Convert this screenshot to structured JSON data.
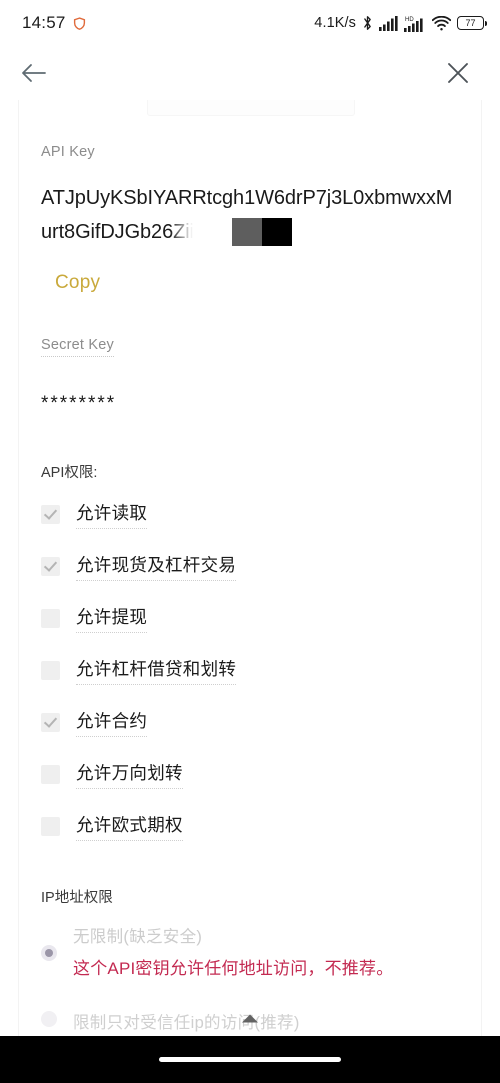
{
  "status_bar": {
    "time": "14:57",
    "shield_icon": "shield-icon",
    "network_speed": "4.1K/s",
    "bluetooth_icon": "bluetooth-icon",
    "signal_icon": "cellular-signal-icon",
    "hd_label": "HD",
    "signal2_icon": "cellular-signal-2-icon",
    "wifi_icon": "wifi-icon",
    "battery_level": "77"
  },
  "app_bar": {
    "back_icon": "back-arrow-icon",
    "close_icon": "close-icon"
  },
  "api_key_section": {
    "label": "API Key",
    "value_line1": "ATJpUyKSbIYARRtcgh1W6drP7j3L0xbmwxxM",
    "value_line2": "urt8GifDJGb26Zii",
    "copy_label": "Copy"
  },
  "secret_key_section": {
    "label": "Secret Key",
    "value": "********"
  },
  "permissions": {
    "title": "API权限:",
    "items": [
      {
        "label": "允许读取",
        "checked": true
      },
      {
        "label": "允许现货及杠杆交易",
        "checked": true
      },
      {
        "label": "允许提现",
        "checked": false
      },
      {
        "label": "允许杠杆借贷和划转",
        "checked": false
      },
      {
        "label": "允许合约",
        "checked": true
      },
      {
        "label": "允许万向划转",
        "checked": false
      },
      {
        "label": "允许欧式期权",
        "checked": false
      }
    ]
  },
  "ip_section": {
    "title": "IP地址权限",
    "option_unrestricted": {
      "label": "无限制(缺乏安全)",
      "warning": "这个API密钥允许任何地址访问，不推荐。",
      "selected": true
    },
    "option_restricted": {
      "label": "限制只对受信任ip的访问(推荐)",
      "selected": false
    }
  },
  "footer": {
    "collapse_icon": "collapse-up-arrow-icon",
    "home_indicator": "home-indicator"
  },
  "colors": {
    "accent_gold": "#c9a93b",
    "warning_red": "#c32a51",
    "text_primary": "#1a1a1a",
    "text_muted": "#8c8c8c"
  }
}
